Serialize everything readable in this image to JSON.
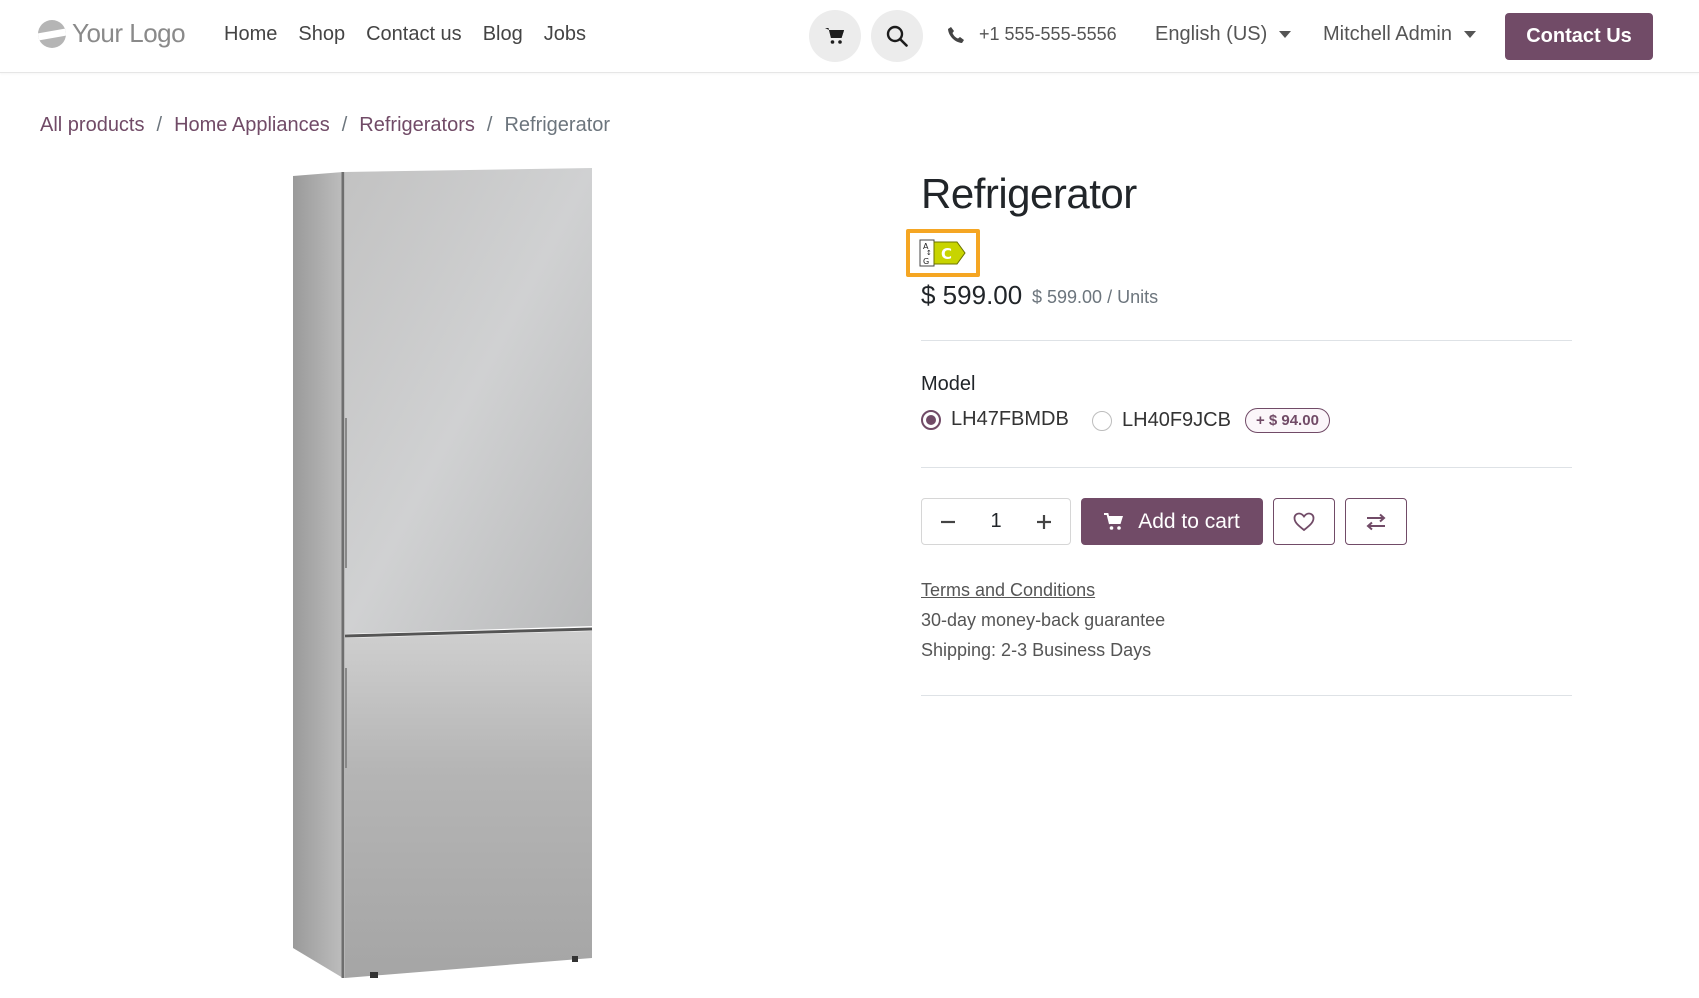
{
  "header": {
    "logo_text": "Your Logo",
    "nav": [
      "Home",
      "Shop",
      "Contact us",
      "Blog",
      "Jobs"
    ],
    "phone": "+1 555-555-5556",
    "language": "English (US)",
    "user": "Mitchell Admin",
    "contact_button": "Contact Us"
  },
  "breadcrumb": {
    "items": [
      "All products",
      "Home Appliances",
      "Refrigerators"
    ],
    "current": "Refrigerator"
  },
  "product": {
    "title": "Refrigerator",
    "energy_label": {
      "scale_top": "A",
      "scale_bottom": "G",
      "class": "C"
    },
    "price": "$ 599.00",
    "unit_price": "$ 599.00 / Units",
    "attribute_label": "Model",
    "variants": [
      {
        "label": "LH47FBMDB",
        "selected": true,
        "extra": ""
      },
      {
        "label": "LH40F9JCB",
        "selected": false,
        "extra": "+ $ 94.00"
      }
    ],
    "quantity": "1",
    "add_to_cart": "Add to cart",
    "terms": "Terms and Conditions",
    "guarantee": "30-day money-back guarantee",
    "shipping": "Shipping: 2-3 Business Days"
  },
  "colors": {
    "brand": "#714b67",
    "highlight": "#f5a623",
    "energy_c": "#c8d400"
  },
  "icons": {
    "cart": "cart-icon",
    "search": "search-icon",
    "phone": "phone-icon",
    "heart": "heart-icon",
    "compare": "compare-icon"
  }
}
